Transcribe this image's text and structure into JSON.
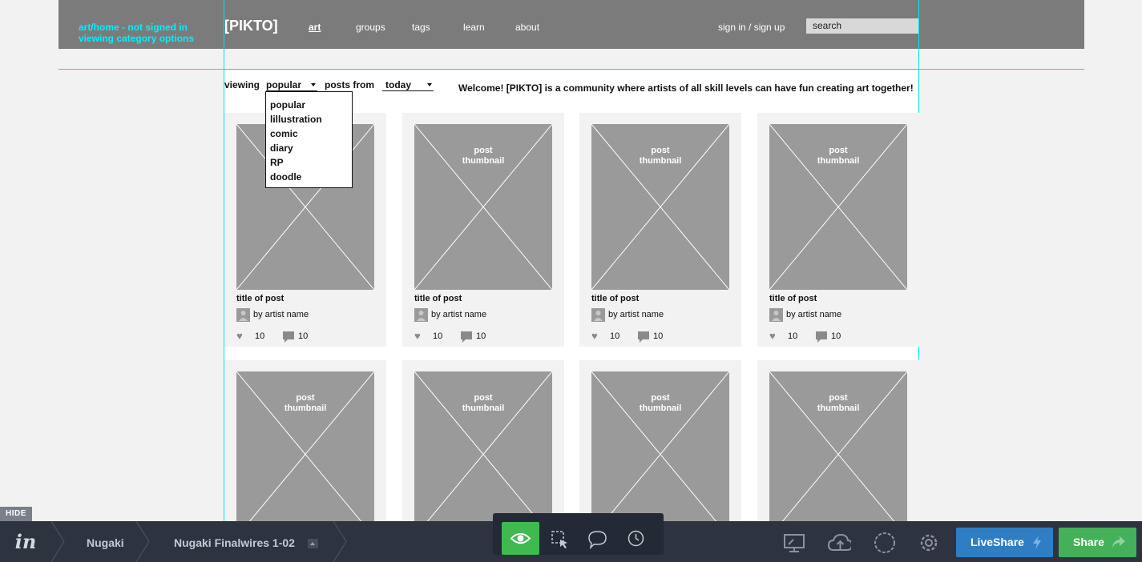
{
  "header": {
    "annotation_line1": "art/home - not signed in",
    "annotation_line2": "viewing category options",
    "logo": "[PIKTO]",
    "nav": [
      "art",
      "groups",
      "tags",
      "learn",
      "about"
    ],
    "signin": "sign in / sign up",
    "search_placeholder": "search"
  },
  "filters": {
    "viewing_label": "viewing",
    "category_selected": "popular",
    "posts_from_label": "posts from",
    "period_selected": "today",
    "welcome": "Welcome! [PIKTO] is a community where artists of all skill levels can have fun creating art together!"
  },
  "category_options": [
    "popular",
    "lillustration",
    "comic",
    "diary",
    "RP",
    "doodle"
  ],
  "posts": {
    "thumb_line1": "post",
    "thumb_line2": "thumbnail",
    "title": "title of post",
    "artist": "by artist name",
    "likes": "10",
    "comments": "10"
  },
  "invision": {
    "hide": "HIDE",
    "logo": "in",
    "project": "Nugaki",
    "screen": "Nugaki Finalwires 1-02",
    "liveshare": "LiveShare",
    "share": "Share",
    "colors": {
      "bar": "#2d3440",
      "active_tool": "#3fb950",
      "liveshare": "#2f7ec4",
      "share": "#45b05a",
      "annotation": "#00f0ff"
    }
  }
}
